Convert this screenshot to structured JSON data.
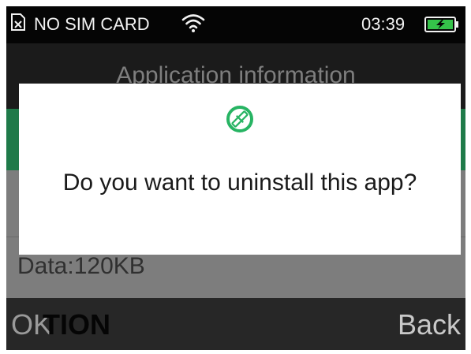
{
  "status_bar": {
    "sim_icon": "no-sim-icon",
    "sim_text": "NO SIM CARD",
    "wifi_icon": "wifi-icon",
    "time": "03:39",
    "battery_icon": "battery-charging-icon",
    "battery_color": "#35c24a"
  },
  "background_screen": {
    "title": "Application information",
    "data_row": "Data:120KB"
  },
  "dialog": {
    "icon": "uninstall-app-icon",
    "icon_color": "#27b463",
    "message": "Do you want to uninstall this app?"
  },
  "softkeys": {
    "left_label": "OK",
    "left_underlying": "TION",
    "right_label": "Back"
  }
}
